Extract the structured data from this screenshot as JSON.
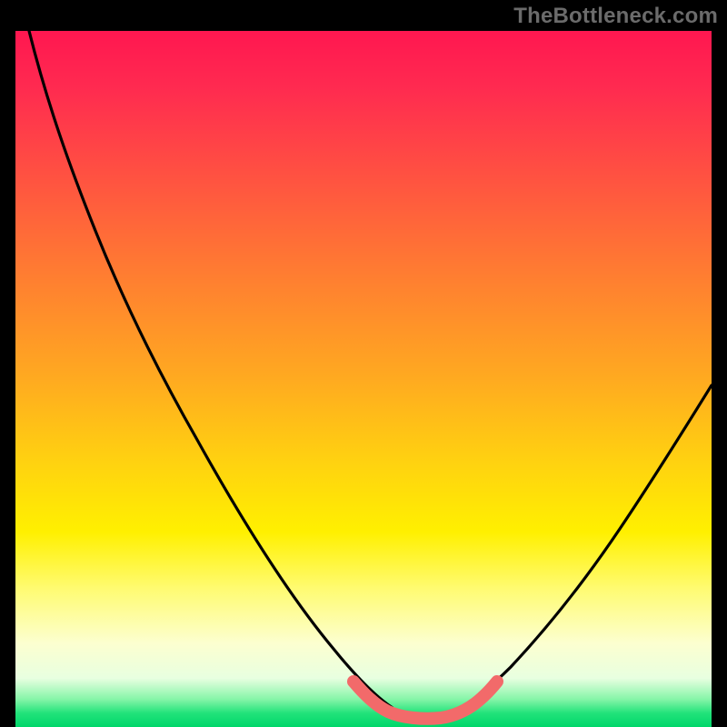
{
  "watermark": "TheBottleneck.com",
  "chart_data": {
    "type": "line",
    "title": "",
    "xlabel": "",
    "ylabel": "",
    "xlim": [
      0,
      100
    ],
    "ylim": [
      0,
      100
    ],
    "grid": false,
    "legend": false,
    "annotations": [],
    "gradient_stops": [
      {
        "pct": 0,
        "color": "#ff1750"
      },
      {
        "pct": 22,
        "color": "#ff5540"
      },
      {
        "pct": 50,
        "color": "#ffaa20"
      },
      {
        "pct": 72,
        "color": "#fff000"
      },
      {
        "pct": 88,
        "color": "#fcffd0"
      },
      {
        "pct": 96,
        "color": "#86f5a8"
      },
      {
        "pct": 100,
        "color": "#00d66a"
      }
    ],
    "series": [
      {
        "name": "curve",
        "color": "#000000",
        "x": [
          2,
          6,
          10,
          14,
          18,
          22,
          26,
          30,
          34,
          38,
          42,
          46,
          49,
          52,
          55,
          57,
          59,
          62,
          66,
          70,
          74,
          78,
          82,
          86,
          90,
          94,
          98,
          100
        ],
        "y": [
          100,
          94,
          88,
          82,
          75,
          68,
          60,
          52,
          44,
          36,
          28,
          20,
          13,
          7,
          3,
          1,
          0.2,
          0.2,
          1,
          3,
          7,
          12,
          18,
          25,
          33,
          42,
          51,
          56
        ]
      },
      {
        "name": "valley-highlight",
        "color": "#f26a6a",
        "x": [
          49,
          51,
          53,
          55,
          57,
          59,
          61,
          63,
          65
        ],
        "y": [
          5,
          3,
          1.5,
          0.6,
          0.2,
          0.2,
          0.5,
          1.4,
          3
        ]
      }
    ]
  }
}
